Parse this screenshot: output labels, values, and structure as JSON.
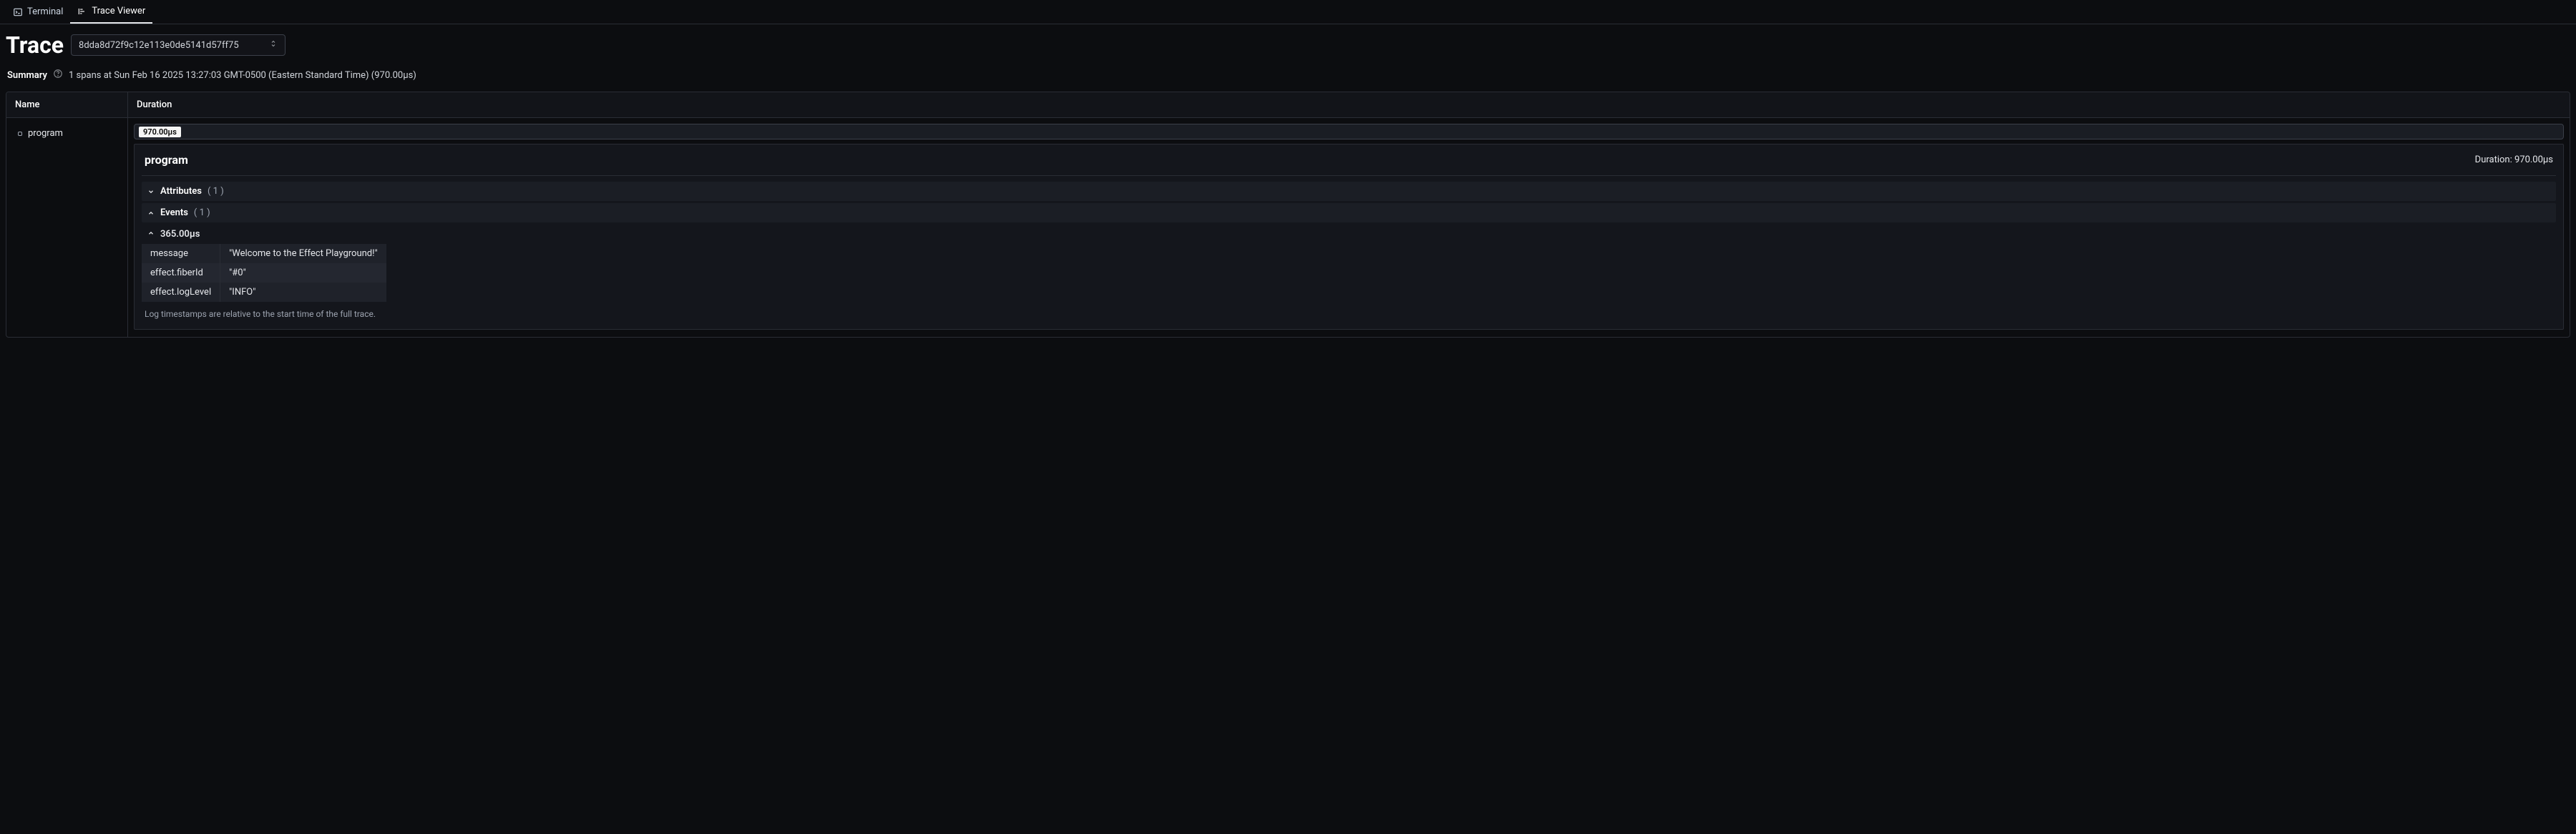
{
  "tabs": {
    "terminal": "Terminal",
    "trace_viewer": "Trace Viewer"
  },
  "toolbar": {
    "title": "Trace",
    "trace_id": "8dda8d72f9c12e113e0de5141d57ff75"
  },
  "summary": {
    "label": "Summary",
    "text": "1 spans at Sun Feb 16 2025 13:27:03 GMT-0500 (Eastern Standard Time) (970.00µs)"
  },
  "columns": {
    "name": "Name",
    "duration": "Duration"
  },
  "span": {
    "name": "program",
    "bar_label": "970.00µs"
  },
  "detail": {
    "name": "program",
    "duration_label": "Duration: 970.00µs",
    "attributes": {
      "title": "Attributes",
      "count": "( 1 )"
    },
    "events": {
      "title": "Events",
      "count": "( 1 )"
    },
    "event0": {
      "timestamp": "365.00µs",
      "rows": [
        {
          "k": "message",
          "v": "\"Welcome to the Effect Playground!\""
        },
        {
          "k": "effect.fiberId",
          "v": "\"#0\""
        },
        {
          "k": "effect.logLevel",
          "v": "\"INFO\""
        }
      ]
    },
    "footnote": "Log timestamps are relative to the start time of the full trace."
  }
}
